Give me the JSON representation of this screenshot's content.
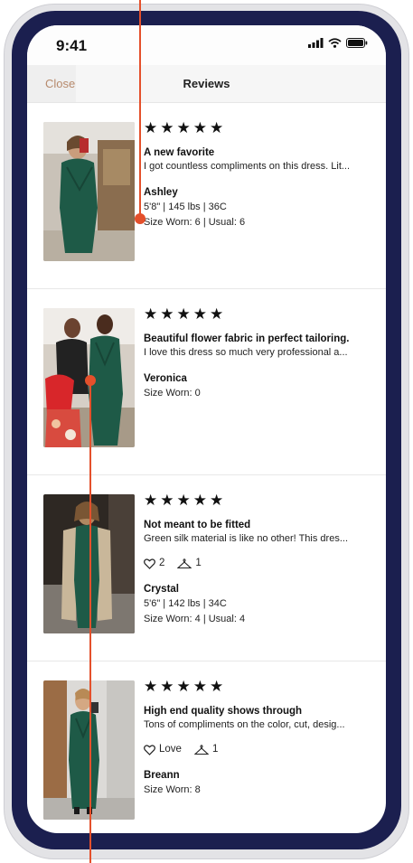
{
  "status_bar": {
    "time": "9:41"
  },
  "nav": {
    "close": "Close",
    "title": "Reviews"
  },
  "stars": "★★★★★",
  "reviews": [
    {
      "stars": "★★★★★",
      "headline": "A new favorite",
      "body": "I got countless compliments on this dress. Lit...",
      "name": "Ashley",
      "measurements": "5'8\"  |  145 lbs  |  36C",
      "size": "Size Worn: 6  |  Usual: 6"
    },
    {
      "stars": "★★★★★",
      "headline": "Beautiful flower fabric in perfect tailoring.",
      "body": "I love this dress so much very professional a...",
      "name": "Veronica",
      "size": "Size Worn: 0"
    },
    {
      "stars": "★★★★★",
      "headline": "Not meant to be fitted",
      "body": "Green silk material is like no other! This dres...",
      "like_label": "2",
      "hanger_count": "1",
      "name": "Crystal",
      "measurements": "5'6\"  |  142 lbs  |  34C",
      "size": "Size Worn: 4  |  Usual: 4"
    },
    {
      "stars": "★★★★★",
      "headline": "High end quality shows through",
      "body": "Tons of compliments on the color, cut, desig...",
      "like_label": "Love",
      "hanger_count": "1",
      "name": "Breann",
      "size": "Size Worn: 8"
    }
  ],
  "colors": {
    "bezel": "#1b1f4f",
    "accent_close": "#b78a6c",
    "annotation": "#e4502b",
    "dress_green": "#1e5a47"
  },
  "icons": [
    "signal-icon",
    "wifi-icon",
    "battery-icon",
    "heart-icon",
    "hanger-icon"
  ]
}
